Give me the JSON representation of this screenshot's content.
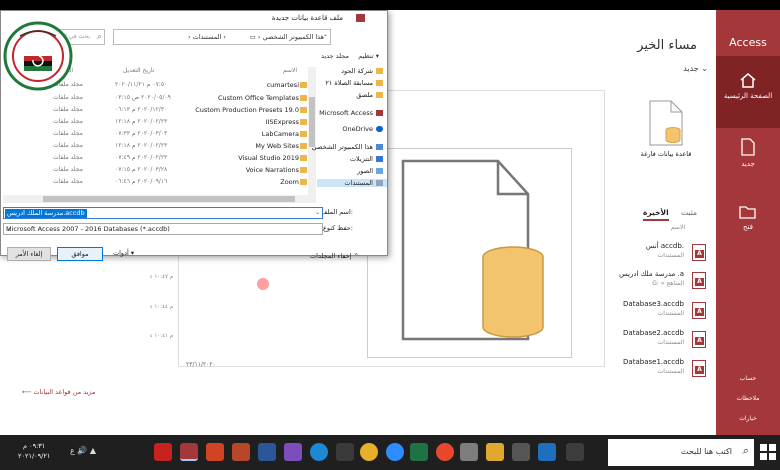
{
  "access": {
    "brand": "Access",
    "nav": [
      {
        "label": "الصفحة الرئيسية",
        "icon": "home-icon"
      },
      {
        "label": "جديد",
        "icon": "new-document-icon"
      },
      {
        "label": "فتح",
        "icon": "open-folder-icon"
      }
    ],
    "nav_bottom": [
      "حساب",
      "ملاحظات",
      "خيارات"
    ],
    "greeting": "مساء الخير",
    "new_header": "جديد",
    "blank_database_label": "قاعدة بيانات فارغة",
    "tabs": {
      "recent": "الأخيرة",
      "pinned": "مثبت"
    },
    "name_column": "الاسم",
    "recent_files": [
      {
        "name": "أنس accdb.",
        "path": "المستندات",
        "time": ""
      },
      {
        "name": "مدرسة ملك ادريس .a",
        "path": "G: » المناهج",
        "time": "م ١٠:٤٧ ء"
      },
      {
        "name": "Database3.accdb",
        "path": "المستندات",
        "time": "م ١٠:٤٤ ء"
      },
      {
        "name": "Database2.accdb",
        "path": "المستندات",
        "time": "م ١٠:٤١ ء"
      },
      {
        "name": "Database1.accdb",
        "path": "المستندات",
        "time": ""
      }
    ],
    "preview_date": "٢٣/١١/٢٠٢٠",
    "more_databases": "مزيد من قواعد البيانات",
    "accent": "#a4373a"
  },
  "dialog": {
    "title": "ملف قاعدة بيانات جديدة",
    "breadcrumb": [
      "هذا الكمبيوتر الشخصي",
      "المستندات"
    ],
    "search_placeholder": "بحث في المستندات",
    "organize": "تنظيم",
    "new_folder": "مجلد جديد",
    "columns": {
      "name": "الاسم",
      "date": "تاريخ التعديل",
      "type": "النوع"
    },
    "files": [
      {
        "name": "cumartesi",
        "date": "٠٧:٥٠ م ٢٠٢٠/١١/٢١",
        "type": "مجلد ملفات"
      },
      {
        "name": "Custom Office Templates",
        "date": "٢٠٢٠/٠٥/٠٩ ص ٠٣:١٥",
        "type": "مجلد ملفات"
      },
      {
        "name": "Custom Production Presets 19.0",
        "date": "٢٠٢٠/١٢/٣٠ م ٠٦:١٣",
        "type": "مجلد ملفات"
      },
      {
        "name": "IISExpress",
        "date": "٢٠٢٠/٠٢/٢٣ م ١٢:١٨",
        "type": "مجلد ملفات"
      },
      {
        "name": "LabCamera",
        "date": "٢٠٢٠/٠٣/٠٣ م ٠٧:٣٣",
        "type": "مجلد ملفات"
      },
      {
        "name": "My Web Sites",
        "date": "٢٠٢٠/٠٢/٢٣ م ١٢:١٨",
        "type": "مجلد ملفات"
      },
      {
        "name": "Visual Studio 2019",
        "date": "٢٠٢٠/٠٢/٢٣ م ٠٧:٤٩",
        "type": "مجلد ملفات"
      },
      {
        "name": "Voice Narrations",
        "date": "٢٠٢٠/٠٣/٢٨ م ٠٧:١٥",
        "type": "مجلد ملفات"
      },
      {
        "name": "Zoom",
        "date": "٢٠٢٠/٠٩/١٦ م ٠٦:٤٦",
        "type": "مجلد ملفات"
      }
    ],
    "nav_items": [
      {
        "label": "شركة الجود",
        "icon": "folder-icon"
      },
      {
        "label": "مسابقة الصلاة ٢١",
        "icon": "folder-icon"
      },
      {
        "label": "ملصق",
        "icon": "folder-icon"
      },
      {
        "label": "Microsoft Access",
        "icon": "access-icon"
      },
      {
        "label": "OneDrive",
        "icon": "onedrive-icon"
      },
      {
        "label": "هذا الكمبيوتر الشخصي",
        "icon": "computer-icon"
      },
      {
        "label": "التنزيلات",
        "icon": "downloads-icon"
      },
      {
        "label": "الصور",
        "icon": "pictures-icon"
      },
      {
        "label": "المستندات",
        "icon": "documents-icon"
      }
    ],
    "file_name_label": "اسم الملف:",
    "file_name_value": "مدرسة الملك ادريس.accdb",
    "save_type_label": "حفظ كنوع:",
    "save_type_value": "Microsoft Access 2007 - 2016 Databases (*.accdb)",
    "hide_folders": "إخفاء المجلدات",
    "tools": "أدوات",
    "ok": "موافق",
    "cancel": "إلغاء الأمر"
  },
  "taskbar": {
    "search_placeholder": "اكتب هنا للبحث",
    "clock_time": "٠٩:٣١ م",
    "clock_date": "٢٠٢١/٠٩/٢١",
    "tray_lang": "ع"
  }
}
